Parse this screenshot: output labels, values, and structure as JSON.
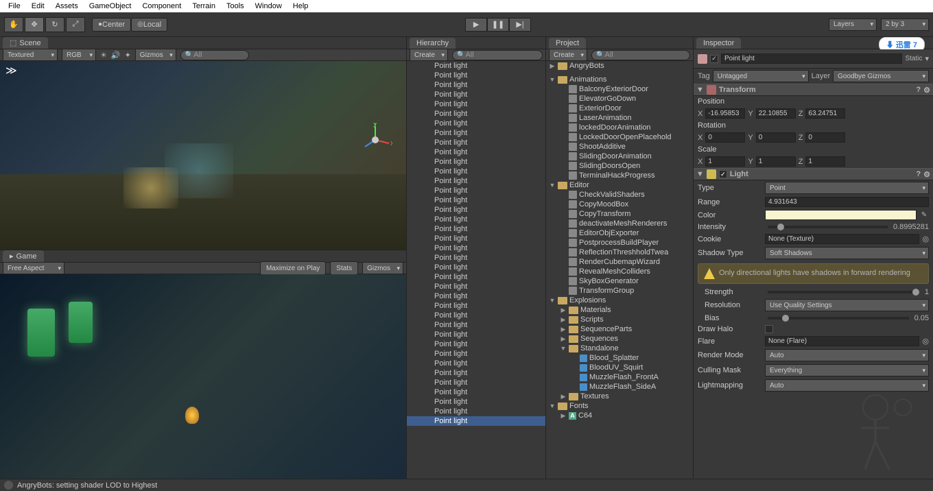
{
  "menu": [
    "File",
    "Edit",
    "Assets",
    "GameObject",
    "Component",
    "Terrain",
    "Tools",
    "Window",
    "Help"
  ],
  "toolbar": {
    "center": "Center",
    "local": "Local",
    "layers": "Layers",
    "layout": "2 by 3"
  },
  "scene": {
    "tab": "Scene",
    "textured": "Textured",
    "rgb": "RGB",
    "gizmos": "Gizmos",
    "search_placeholder": "All"
  },
  "game": {
    "tab": "Game",
    "aspect": "Free Aspect",
    "maximize": "Maximize on Play",
    "stats": "Stats",
    "gizmos": "Gizmos"
  },
  "hierarchy": {
    "tab": "Hierarchy",
    "create": "Create",
    "search_placeholder": "All",
    "items": [
      "Point light",
      "Point light",
      "Point light",
      "Point light",
      "Point light",
      "Point light",
      "Point light",
      "Point light",
      "Point light",
      "Point light",
      "Point light",
      "Point light",
      "Point light",
      "Point light",
      "Point light",
      "Point light",
      "Point light",
      "Point light",
      "Point light",
      "Point light",
      "Point light",
      "Point light",
      "Point light",
      "Point light",
      "Point light",
      "Point light",
      "Point light",
      "Point light",
      "Point light",
      "Point light",
      "Point light",
      "Point light",
      "Point light",
      "Point light",
      "Point light",
      "Point light",
      "Point light",
      "Point light"
    ],
    "selected_index": 37
  },
  "project": {
    "tab": "Project",
    "create": "Create",
    "search_placeholder": "All",
    "tree": [
      {
        "name": "AngryBots",
        "type": "folder",
        "indent": 0,
        "fold": "▶"
      },
      {
        "name": "",
        "type": "spacer",
        "indent": 0
      },
      {
        "name": "Animations",
        "type": "folder",
        "indent": 0,
        "fold": "▼"
      },
      {
        "name": "BalconyExteriorDoor",
        "type": "file",
        "indent": 1
      },
      {
        "name": "ElevatorGoDown",
        "type": "file",
        "indent": 1
      },
      {
        "name": "ExteriorDoor",
        "type": "file",
        "indent": 1
      },
      {
        "name": "LaserAnimation",
        "type": "file",
        "indent": 1
      },
      {
        "name": "lockedDoorAnimation",
        "type": "file",
        "indent": 1
      },
      {
        "name": "LockedDoorOpenPlacehold",
        "type": "file",
        "indent": 1
      },
      {
        "name": "ShootAdditive",
        "type": "file",
        "indent": 1
      },
      {
        "name": "SlidingDoorAnimation",
        "type": "file",
        "indent": 1
      },
      {
        "name": "SlidingDoorsOpen",
        "type": "file",
        "indent": 1
      },
      {
        "name": "TerminalHackProgress",
        "type": "file",
        "indent": 1
      },
      {
        "name": "Editor",
        "type": "folder",
        "indent": 0,
        "fold": "▼"
      },
      {
        "name": "CheckValidShaders",
        "type": "file",
        "indent": 1
      },
      {
        "name": "CopyMoodBox",
        "type": "file",
        "indent": 1
      },
      {
        "name": "CopyTransform",
        "type": "file",
        "indent": 1
      },
      {
        "name": "deactivateMeshRenderers",
        "type": "file",
        "indent": 1
      },
      {
        "name": "EditorObjExporter",
        "type": "file",
        "indent": 1
      },
      {
        "name": "PostprocessBuildPlayer",
        "type": "file",
        "indent": 1
      },
      {
        "name": "ReflectionThreshholdTwea",
        "type": "file",
        "indent": 1
      },
      {
        "name": "RenderCubemapWizard",
        "type": "file",
        "indent": 1
      },
      {
        "name": "RevealMeshColliders",
        "type": "file",
        "indent": 1
      },
      {
        "name": "SkyBoxGenerator",
        "type": "file",
        "indent": 1
      },
      {
        "name": "TransformGroup",
        "type": "file",
        "indent": 1
      },
      {
        "name": "Explosions",
        "type": "folder",
        "indent": 0,
        "fold": "▼"
      },
      {
        "name": "Materials",
        "type": "folder",
        "indent": 1,
        "fold": "▶"
      },
      {
        "name": "Scripts",
        "type": "folder",
        "indent": 1,
        "fold": "▶"
      },
      {
        "name": "SequenceParts",
        "type": "folder",
        "indent": 1,
        "fold": "▶"
      },
      {
        "name": "Sequences",
        "type": "folder",
        "indent": 1,
        "fold": "▶"
      },
      {
        "name": "Standalone",
        "type": "folder",
        "indent": 1,
        "fold": "▼"
      },
      {
        "name": "Blood_Splatter",
        "type": "prefab",
        "indent": 2
      },
      {
        "name": "BloodUV_Squirt",
        "type": "prefab",
        "indent": 2
      },
      {
        "name": "MuzzleFlash_FrontA",
        "type": "prefab",
        "indent": 2
      },
      {
        "name": "MuzzleFlash_SideA",
        "type": "prefab",
        "indent": 2
      },
      {
        "name": "Textures",
        "type": "folder",
        "indent": 1,
        "fold": "▶"
      },
      {
        "name": "Fonts",
        "type": "folder",
        "indent": 0,
        "fold": "▼"
      },
      {
        "name": "C64",
        "type": "font",
        "indent": 1,
        "fold": "▶"
      }
    ]
  },
  "inspector": {
    "tab": "Inspector",
    "name": "Point light",
    "static_label": "Static",
    "tag_label": "Tag",
    "tag_value": "Untagged",
    "layer_label": "Layer",
    "layer_value": "Goodbye Gizmos",
    "transform": {
      "title": "Transform",
      "position": "Position",
      "rotation": "Rotation",
      "scale": "Scale",
      "px": "-16.95853",
      "py": "22.10855",
      "pz": "63.24751",
      "rx": "0",
      "ry": "0",
      "rz": "0",
      "sx": "1",
      "sy": "1",
      "sz": "1"
    },
    "light": {
      "title": "Light",
      "type_label": "Type",
      "type_value": "Point",
      "range_label": "Range",
      "range_value": "4.931643",
      "color_label": "Color",
      "color_value": "#f8f4d0",
      "intensity_label": "Intensity",
      "intensity_value": "0.8995281",
      "cookie_label": "Cookie",
      "cookie_value": "None (Texture)",
      "shadow_label": "Shadow Type",
      "shadow_value": "Soft Shadows",
      "warning": "Only directional lights have shadows in forward rendering",
      "strength_label": "Strength",
      "strength_value": "1",
      "resolution_label": "Resolution",
      "resolution_value": "Use Quality Settings",
      "bias_label": "Bias",
      "bias_value": "0.05",
      "drawhalo_label": "Draw Halo",
      "flare_label": "Flare",
      "flare_value": "None (Flare)",
      "rendermode_label": "Render Mode",
      "rendermode_value": "Auto",
      "cullingmask_label": "Culling Mask",
      "cullingmask_value": "Everything",
      "lightmapping_label": "Lightmapping",
      "lightmapping_value": "Auto"
    }
  },
  "status": "AngryBots: setting shader LOD to Highest",
  "watermark": "迅雷 7"
}
